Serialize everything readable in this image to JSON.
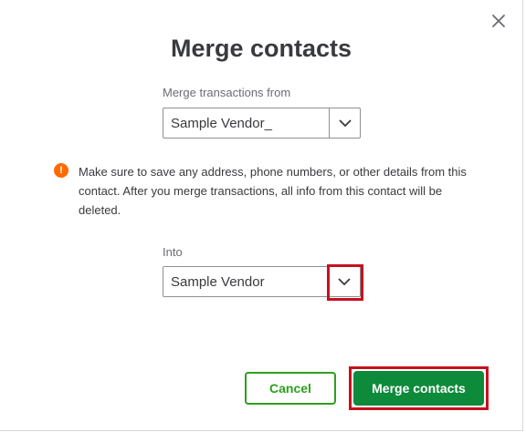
{
  "dialog": {
    "title": "Merge contacts",
    "from": {
      "label": "Merge transactions from",
      "value": "Sample Vendor_"
    },
    "warning": {
      "text": "Make sure to save any address, phone numbers, or other details from this contact. After you merge transactions, all info from this contact will be deleted."
    },
    "into": {
      "label": "Into",
      "value": "Sample Vendor"
    },
    "buttons": {
      "cancel": "Cancel",
      "merge": "Merge contacts"
    },
    "warning_icon_glyph": "!",
    "colors": {
      "primary_green": "#2ca01c",
      "merge_button": "#0e8a3b",
      "warning_orange": "#ff6a00",
      "highlight_red": "#c8101e",
      "text": "#393a3d"
    }
  }
}
